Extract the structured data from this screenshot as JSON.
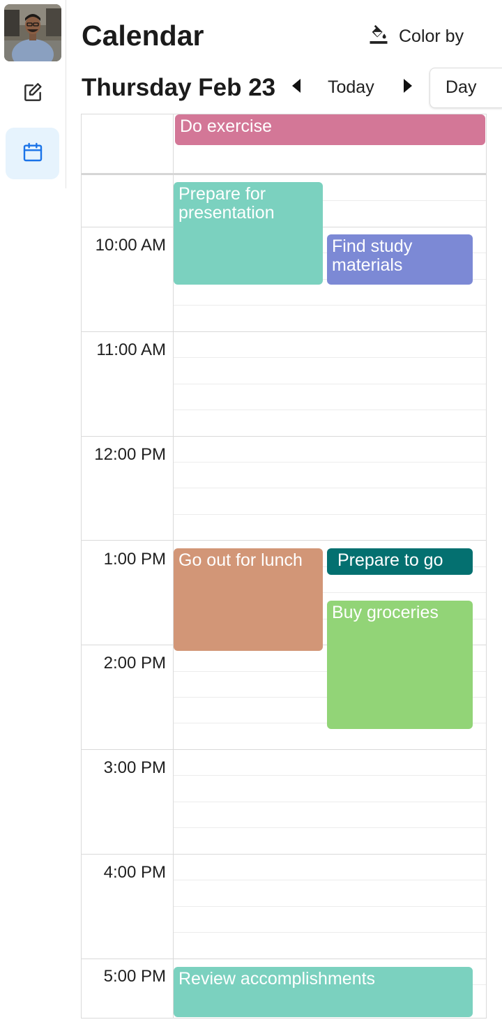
{
  "header": {
    "title": "Calendar",
    "color_by_label": "Color by",
    "date": "Thursday Feb 23",
    "today_label": "Today",
    "view_label": "Day"
  },
  "time_labels": [
    "10:00 AM",
    "11:00 AM",
    "12:00 PM",
    "1:00 PM",
    "2:00 PM",
    "3:00 PM",
    "4:00 PM",
    "5:00 PM"
  ],
  "events": [
    {
      "title": "Do exercise",
      "color": "#d37797",
      "all_day": true
    },
    {
      "title": "Prepare for presentation",
      "color": "#7bd1bf"
    },
    {
      "title": "Find study materials",
      "color": "#7c89d5"
    },
    {
      "title": "Go out for lunch",
      "color": "#d29677"
    },
    {
      "title": "Prepare to go",
      "color": "#047070"
    },
    {
      "title": "Buy groceries",
      "color": "#92d477"
    },
    {
      "title": "Review accomplishments",
      "color": "#7bd1bf"
    }
  ],
  "colors": {
    "accent": "#1a73e8",
    "nav_active_bg": "#e6f3fd"
  },
  "icons": [
    "edit-icon",
    "calendar-icon",
    "paint-bucket-icon",
    "arrow-left-icon",
    "arrow-right-icon"
  ]
}
